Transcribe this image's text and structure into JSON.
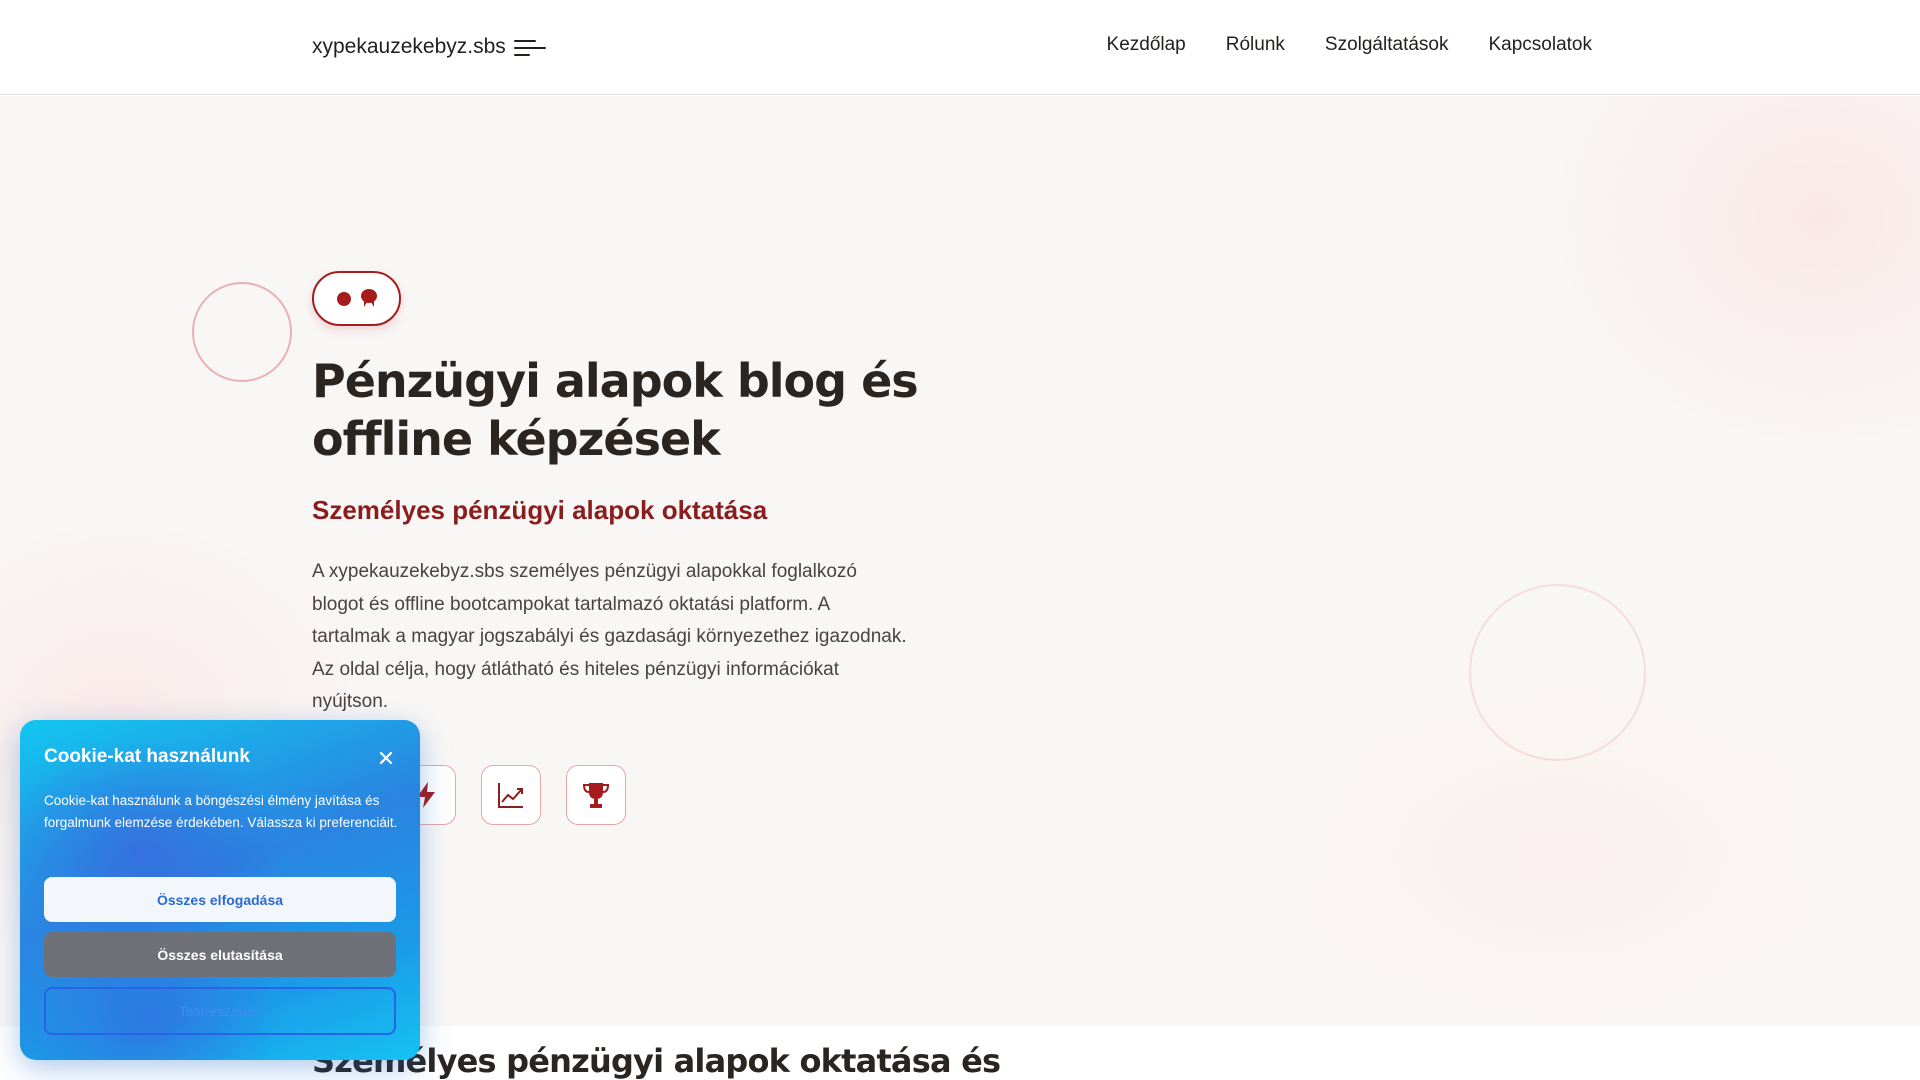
{
  "header": {
    "logo_text": "xypekauzekebyz.sbs",
    "nav": [
      "Kezdőlap",
      "Rólunk",
      "Szolgáltatások",
      "Kapcsolatok"
    ]
  },
  "hero": {
    "title": "Pénzügyi alapok blog és offline képzések",
    "subtitle": "Személyes pénzügyi alapok oktatása",
    "text": "A xypekauzekebyz.sbs személyes pénzügyi alapokkal foglalkozó blogot és offline bootcampokat tartalmazó oktatási platform. A tartalmak a magyar jogszabályi és gazdasági környezethez igazodnak. Az oldal célja, hogy átlátható és hiteles pénzügyi információkat nyújtson.",
    "feature_icons": [
      "lightning-icon",
      "chart-line-icon",
      "trophy-icon"
    ],
    "accent_color": "#a61c1c"
  },
  "section2": {
    "title": "Személyes pénzügyi alapok oktatása és"
  },
  "cookie": {
    "title": "Cookie-kat használunk",
    "text": "Cookie-kat használunk a böngészési élmény javítása és forgalmunk elemzése érdekében. Válassza ki preferenciáit.",
    "accept_label": "Összes elfogadása",
    "reject_label": "Összes elutasítása",
    "customize_label": "Testreszabás"
  }
}
